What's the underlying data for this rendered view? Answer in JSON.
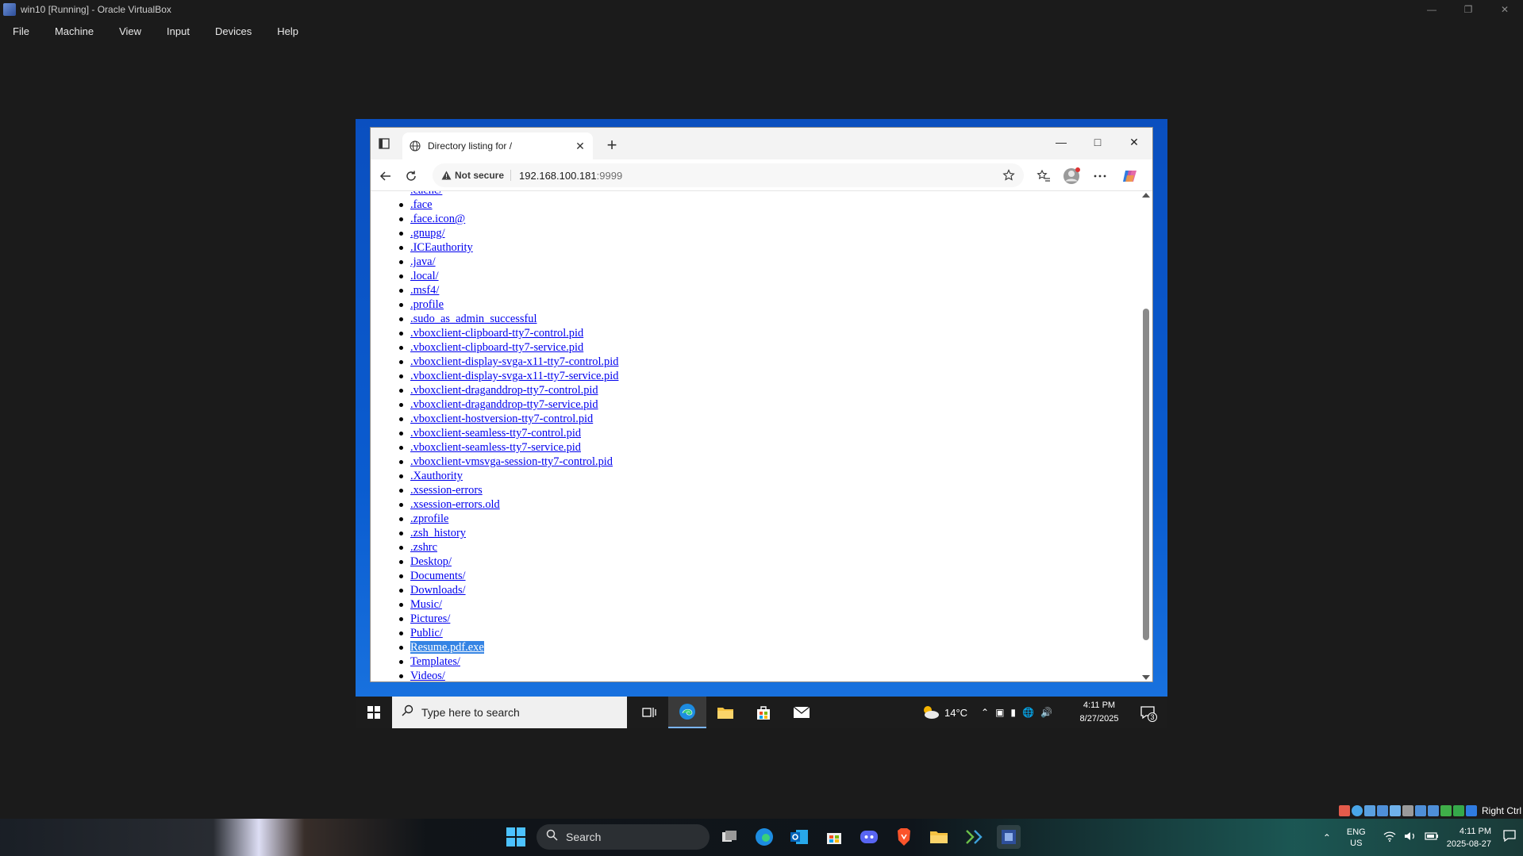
{
  "host": {
    "title": "win10 [Running] - Oracle VirtualBox",
    "menus": [
      "File",
      "Machine",
      "View",
      "Input",
      "Devices",
      "Help"
    ],
    "host_key": "Right Ctrl"
  },
  "browser": {
    "tab_title": "Directory listing for /",
    "not_secure": "Not secure",
    "url_host": "192.168.100.181",
    "url_port": ":9999",
    "partial_top_item": ".cache/",
    "items": [
      {
        "label": ".face",
        "selected": false
      },
      {
        "label": ".face.icon@",
        "selected": false
      },
      {
        "label": ".gnupg/",
        "selected": false
      },
      {
        "label": ".ICEauthority",
        "selected": false
      },
      {
        "label": ".java/",
        "selected": false
      },
      {
        "label": ".local/",
        "selected": false
      },
      {
        "label": ".msf4/",
        "selected": false
      },
      {
        "label": ".profile",
        "selected": false
      },
      {
        "label": ".sudo_as_admin_successful",
        "selected": false
      },
      {
        "label": ".vboxclient-clipboard-tty7-control.pid",
        "selected": false
      },
      {
        "label": ".vboxclient-clipboard-tty7-service.pid",
        "selected": false
      },
      {
        "label": ".vboxclient-display-svga-x11-tty7-control.pid",
        "selected": false
      },
      {
        "label": ".vboxclient-display-svga-x11-tty7-service.pid",
        "selected": false
      },
      {
        "label": ".vboxclient-draganddrop-tty7-control.pid",
        "selected": false
      },
      {
        "label": ".vboxclient-draganddrop-tty7-service.pid",
        "selected": false
      },
      {
        "label": ".vboxclient-hostversion-tty7-control.pid",
        "selected": false
      },
      {
        "label": ".vboxclient-seamless-tty7-control.pid",
        "selected": false
      },
      {
        "label": ".vboxclient-seamless-tty7-service.pid",
        "selected": false
      },
      {
        "label": ".vboxclient-vmsvga-session-tty7-control.pid",
        "selected": false
      },
      {
        "label": ".Xauthority",
        "selected": false
      },
      {
        "label": ".xsession-errors",
        "selected": false
      },
      {
        "label": ".xsession-errors.old",
        "selected": false
      },
      {
        "label": ".zprofile",
        "selected": false
      },
      {
        "label": ".zsh_history",
        "selected": false
      },
      {
        "label": ".zshrc",
        "selected": false
      },
      {
        "label": "Desktop/",
        "selected": false
      },
      {
        "label": "Documents/",
        "selected": false
      },
      {
        "label": "Downloads/",
        "selected": false
      },
      {
        "label": "Music/",
        "selected": false
      },
      {
        "label": "Pictures/",
        "selected": false
      },
      {
        "label": "Public/",
        "selected": false
      },
      {
        "label": "Resume.pdf.exe",
        "selected": true
      },
      {
        "label": "Templates/",
        "selected": false
      },
      {
        "label": "Videos/",
        "selected": false
      }
    ]
  },
  "guest_taskbar": {
    "search_placeholder": "Type here to search",
    "temperature": "14°C",
    "time": "4:11 PM",
    "date": "8/27/2025",
    "notification_count": "3"
  },
  "host_taskbar": {
    "search_label": "Search",
    "lang_line1": "ENG",
    "lang_line2": "US",
    "time": "4:11 PM",
    "date": "2025-08-27"
  },
  "colors": {
    "link": "#0000ee",
    "selection": "#3584e4",
    "guest_desktop": "#0a53c4"
  }
}
